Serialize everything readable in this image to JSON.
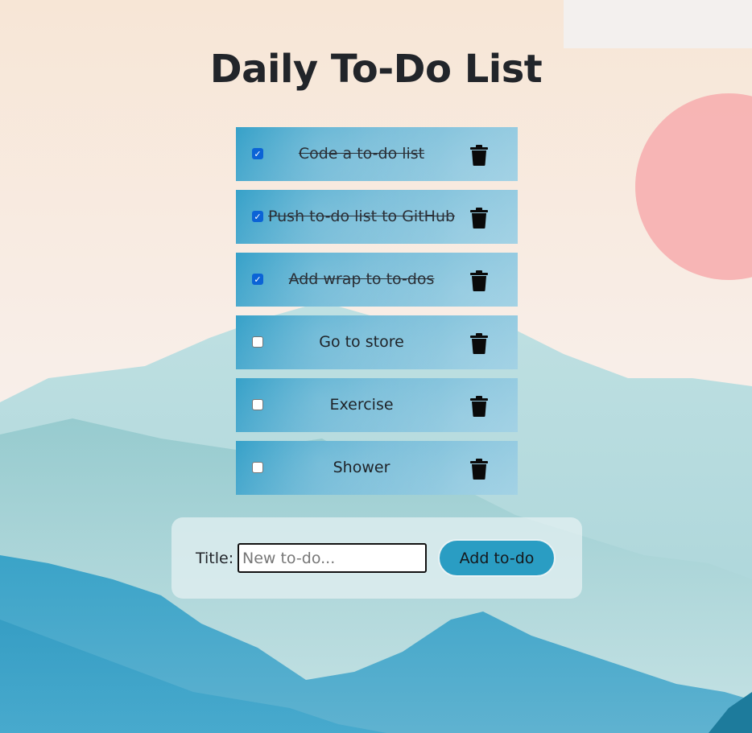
{
  "page": {
    "title": "Daily To-Do List"
  },
  "todos": [
    {
      "text": "Code a to-do list",
      "done": true
    },
    {
      "text": "Push to-do list to GitHub",
      "done": true
    },
    {
      "text": "Add wrap to to-dos",
      "done": true
    },
    {
      "text": "Go to store",
      "done": false
    },
    {
      "text": "Exercise",
      "done": false
    },
    {
      "text": "Shower",
      "done": false
    }
  ],
  "add_form": {
    "label": "Title:",
    "placeholder": "New to-do...",
    "button_label": "Add to-do"
  },
  "colors": {
    "item_accent": "#2c9cc6",
    "checkbox_checked": "#0b63d6",
    "button": "#2a9dc3",
    "sun": "#f7b2b2"
  },
  "icons": {
    "delete": "trash-icon"
  }
}
